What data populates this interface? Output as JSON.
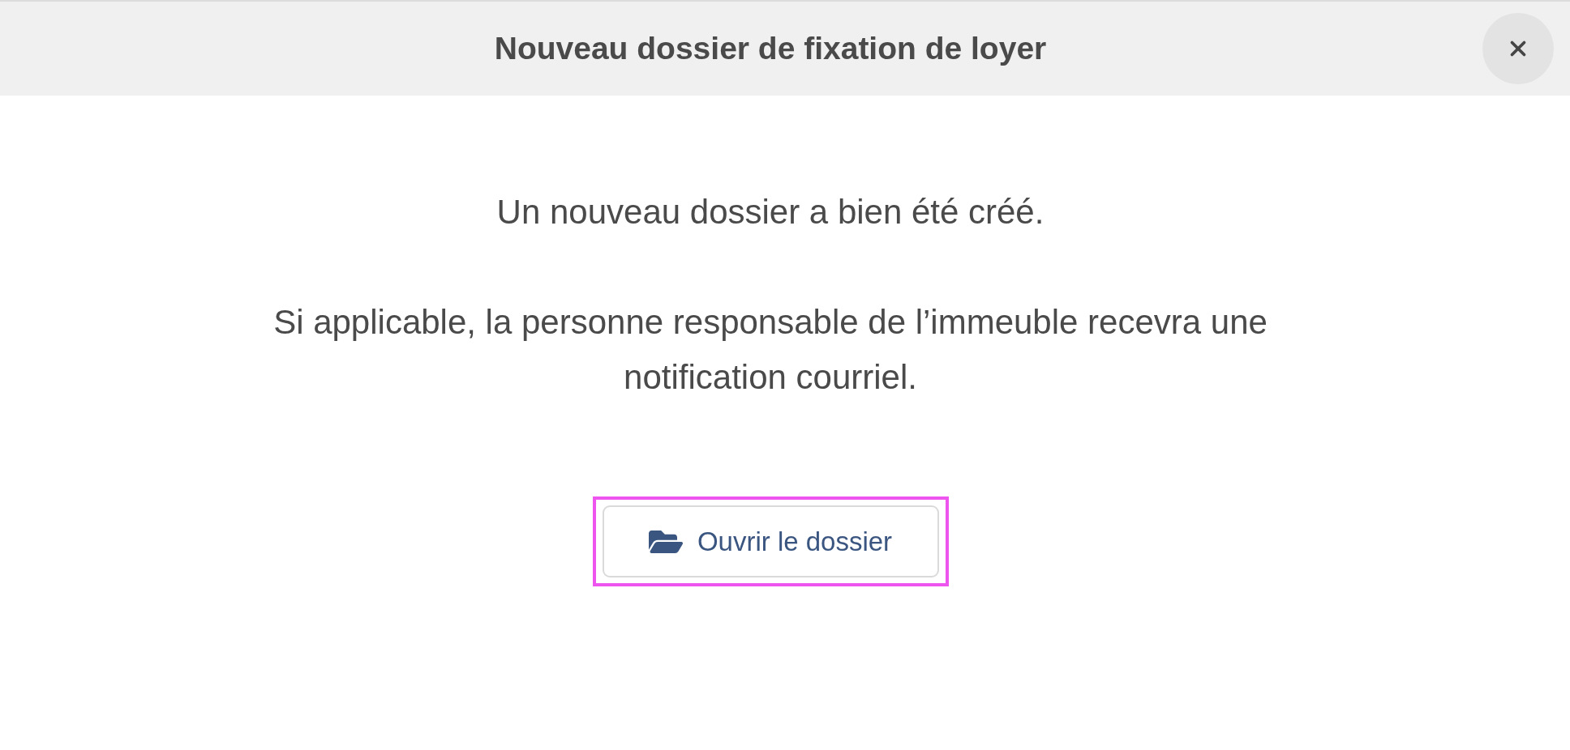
{
  "dialog": {
    "title": "Nouveau dossier de fixation de loyer"
  },
  "message": {
    "paragraphs": [
      "Un nouveau dossier a bien été créé.",
      "Si applicable, la personne responsable de l’immeuble recevra une notification courriel."
    ]
  },
  "action": {
    "label": "Ouvrir le dossier",
    "focused": true
  }
}
